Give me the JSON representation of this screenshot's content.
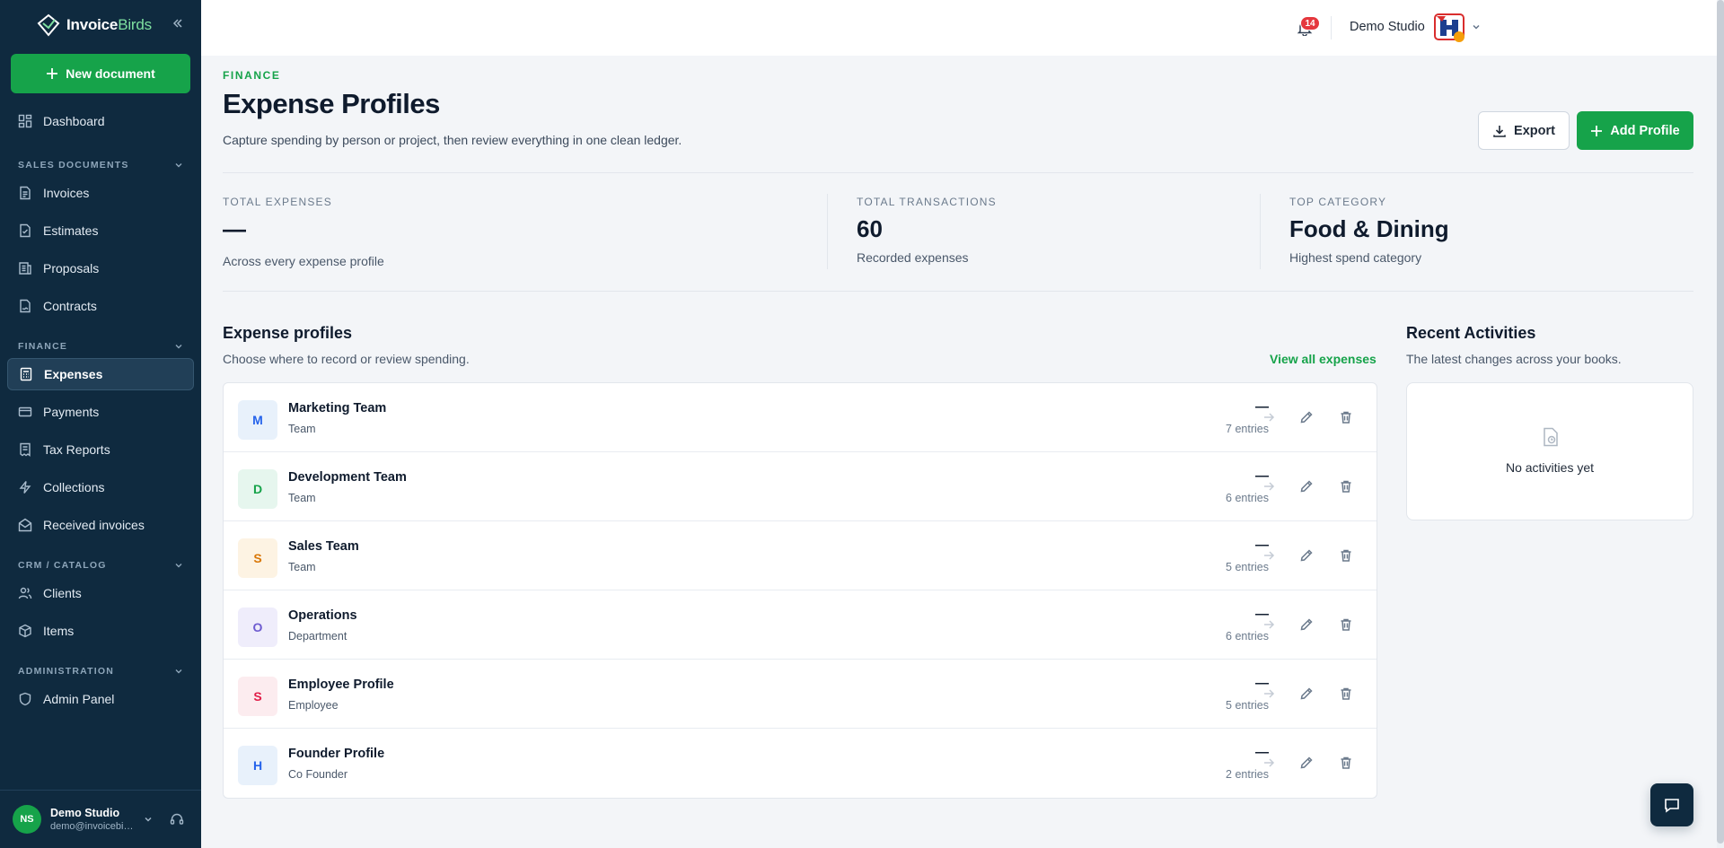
{
  "app": {
    "brand_part1": "Invoice",
    "brand_part2": "Birds",
    "new_document_label": "New document"
  },
  "sidebar": {
    "dashboard": "Dashboard",
    "sections": {
      "sales": "SALES DOCUMENTS",
      "finance": "FINANCE",
      "crm": "CRM / CATALOG",
      "admin": "ADMINISTRATION"
    },
    "items": {
      "invoices": "Invoices",
      "estimates": "Estimates",
      "proposals": "Proposals",
      "contracts": "Contracts",
      "expenses": "Expenses",
      "payments": "Payments",
      "tax_reports": "Tax Reports",
      "collections": "Collections",
      "received_invoices": "Received invoices",
      "clients": "Clients",
      "items": "Items",
      "admin_panel": "Admin Panel"
    },
    "active_item": "Expenses",
    "user": {
      "initials": "NS",
      "name": "Demo Studio",
      "email": "demo@invoicebirds.com"
    }
  },
  "topbar": {
    "notification_count": "14",
    "studio_name": "Demo Studio"
  },
  "page": {
    "eyebrow": "FINANCE",
    "title": "Expense Profiles",
    "subtitle": "Capture spending by person or project, then review everything in one clean ledger.",
    "export_label": "Export",
    "add_profile_label": "Add Profile"
  },
  "stats": [
    {
      "label": "TOTAL EXPENSES",
      "value": "—",
      "caption": "Across every expense profile"
    },
    {
      "label": "TOTAL TRANSACTIONS",
      "value": "60",
      "caption": "Recorded expenses"
    },
    {
      "label": "TOP CATEGORY",
      "value": "Food & Dining",
      "caption": "Highest spend category"
    }
  ],
  "profiles_section": {
    "title": "Expense profiles",
    "subtitle": "Choose where to record or review spending.",
    "view_all": "View all expenses",
    "rows": [
      {
        "initial": "M",
        "name": "Marketing Team",
        "type": "Team",
        "amount": "—",
        "entries": "7 entries",
        "bg": "#e8f1fb",
        "fg": "#2563eb"
      },
      {
        "initial": "D",
        "name": "Development Team",
        "type": "Team",
        "amount": "—",
        "entries": "6 entries",
        "bg": "#e6f6ee",
        "fg": "#16a34a"
      },
      {
        "initial": "S",
        "name": "Sales Team",
        "type": "Team",
        "amount": "—",
        "entries": "5 entries",
        "bg": "#fdf3e3",
        "fg": "#d97706"
      },
      {
        "initial": "O",
        "name": "Operations",
        "type": "Department",
        "amount": "—",
        "entries": "6 entries",
        "bg": "#efedfb",
        "fg": "#6d5bd0"
      },
      {
        "initial": "S",
        "name": "Employee Profile",
        "type": "Employee",
        "amount": "—",
        "entries": "5 entries",
        "bg": "#fcecef",
        "fg": "#e11d48"
      },
      {
        "initial": "H",
        "name": "Founder Profile",
        "type": "Co Founder",
        "amount": "—",
        "entries": "2 entries",
        "bg": "#e8f1fb",
        "fg": "#2563eb"
      }
    ]
  },
  "activities": {
    "title": "Recent Activities",
    "subtitle": "The latest changes across your books.",
    "empty_text": "No activities yet"
  },
  "colors": {
    "sidebar_bg": "#0f2a3f",
    "accent_green": "#16a34a",
    "badge_red": "#e5373d"
  },
  "icons": [
    "logo-icon",
    "collapse-icon",
    "plus-icon",
    "dashboard-icon",
    "invoice-icon",
    "estimate-icon",
    "proposal-icon",
    "contract-icon",
    "expenses-icon",
    "payments-icon",
    "tax-icon",
    "collections-icon",
    "received-icon",
    "clients-icon",
    "items-icon",
    "shield-icon",
    "bell-icon",
    "chevron-down-icon",
    "download-icon",
    "arrow-right-icon",
    "edit-icon",
    "trash-icon",
    "document-clock-icon",
    "chat-icon",
    "headset-icon"
  ]
}
